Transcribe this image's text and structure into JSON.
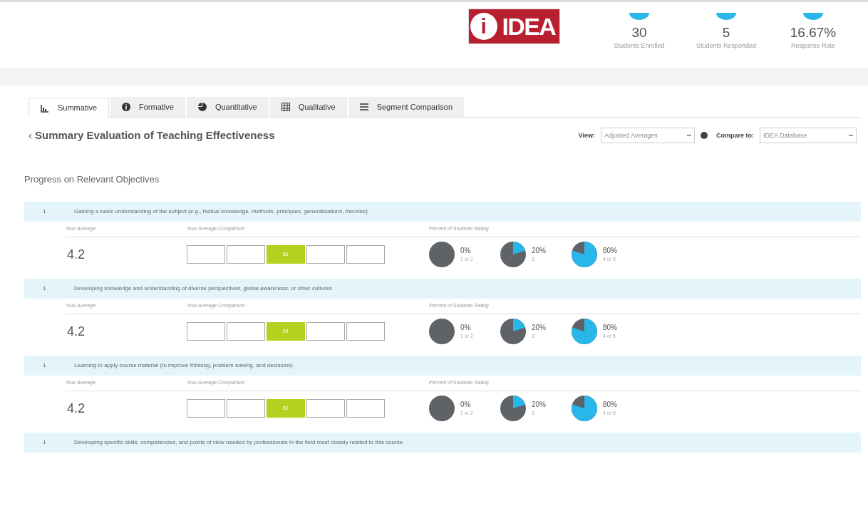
{
  "header": {
    "logo": {
      "mark": "i",
      "word": "IDEA"
    },
    "stats": [
      {
        "value": "30",
        "label": "Students Enrolled"
      },
      {
        "value": "5",
        "label": "Students Responded"
      },
      {
        "value": "16.67%",
        "label": "Response Rate"
      }
    ]
  },
  "tabs": [
    {
      "label": "Summative",
      "selected": true
    },
    {
      "label": "Formative",
      "selected": false
    },
    {
      "label": "Quantitative",
      "selected": false
    },
    {
      "label": "Qualitative",
      "selected": false
    },
    {
      "label": "Segment Comparison",
      "selected": false
    }
  ],
  "section": {
    "back": "‹",
    "title": "Summary Evaluation of Teaching Effectiveness",
    "view_label": "View:",
    "view_value": "Adjusted Averages",
    "compare_label": "Compare to:",
    "compare_value": "IDEA Database"
  },
  "subtitle": "Progress on Relevant Objectives",
  "objectives": [
    {
      "number": "1",
      "text": "Gaining a basic understanding of the subject (e.g., factual knowledge, methods, principles, generalizations, theories)",
      "headers": [
        "Your Average",
        "Your Average Comparison",
        "Percent of Students Rating"
      ],
      "average": "4.2",
      "comparison": [
        {
          "highlighted": false
        },
        {
          "highlighted": false
        },
        {
          "highlighted": true,
          "value": "51"
        },
        {
          "highlighted": false
        },
        {
          "highlighted": false
        }
      ],
      "ratings": [
        {
          "percent": "0%",
          "label": "1 or 2"
        },
        {
          "percent": "20%",
          "label": "3"
        },
        {
          "percent": "80%",
          "label": "4 or 5"
        }
      ]
    },
    {
      "number": "1",
      "text": "Developing knowledge and understanding of diverse perspectives, global awareness, or other cultures",
      "headers": [
        "Your Average",
        "Your Average Comparison",
        "Percent of Students Rating"
      ],
      "average": "4.2",
      "comparison": [
        {
          "highlighted": false
        },
        {
          "highlighted": false
        },
        {
          "highlighted": true,
          "value": "54"
        },
        {
          "highlighted": false
        },
        {
          "highlighted": false
        }
      ],
      "ratings": [
        {
          "percent": "0%",
          "label": "1 or 2"
        },
        {
          "percent": "20%",
          "label": "3"
        },
        {
          "percent": "80%",
          "label": "4 or 5"
        }
      ]
    },
    {
      "number": "1",
      "text": "Learning to apply course material (to improve thinking, problem solving, and decisions)",
      "headers": [
        "Your Average",
        "Your Average Comparison",
        "Percent of Students Rating"
      ],
      "average": "4.2",
      "comparison": [
        {
          "highlighted": false
        },
        {
          "highlighted": false
        },
        {
          "highlighted": true,
          "value": "52"
        },
        {
          "highlighted": false
        },
        {
          "highlighted": false
        }
      ],
      "ratings": [
        {
          "percent": "0%",
          "label": "1 or 2"
        },
        {
          "percent": "20%",
          "label": "3"
        },
        {
          "percent": "80%",
          "label": "4 or 5"
        }
      ]
    },
    {
      "number": "1",
      "text": "Developing specific skills, competencies, and points of view needed by professionals in the field most closely related to this course"
    }
  ]
}
